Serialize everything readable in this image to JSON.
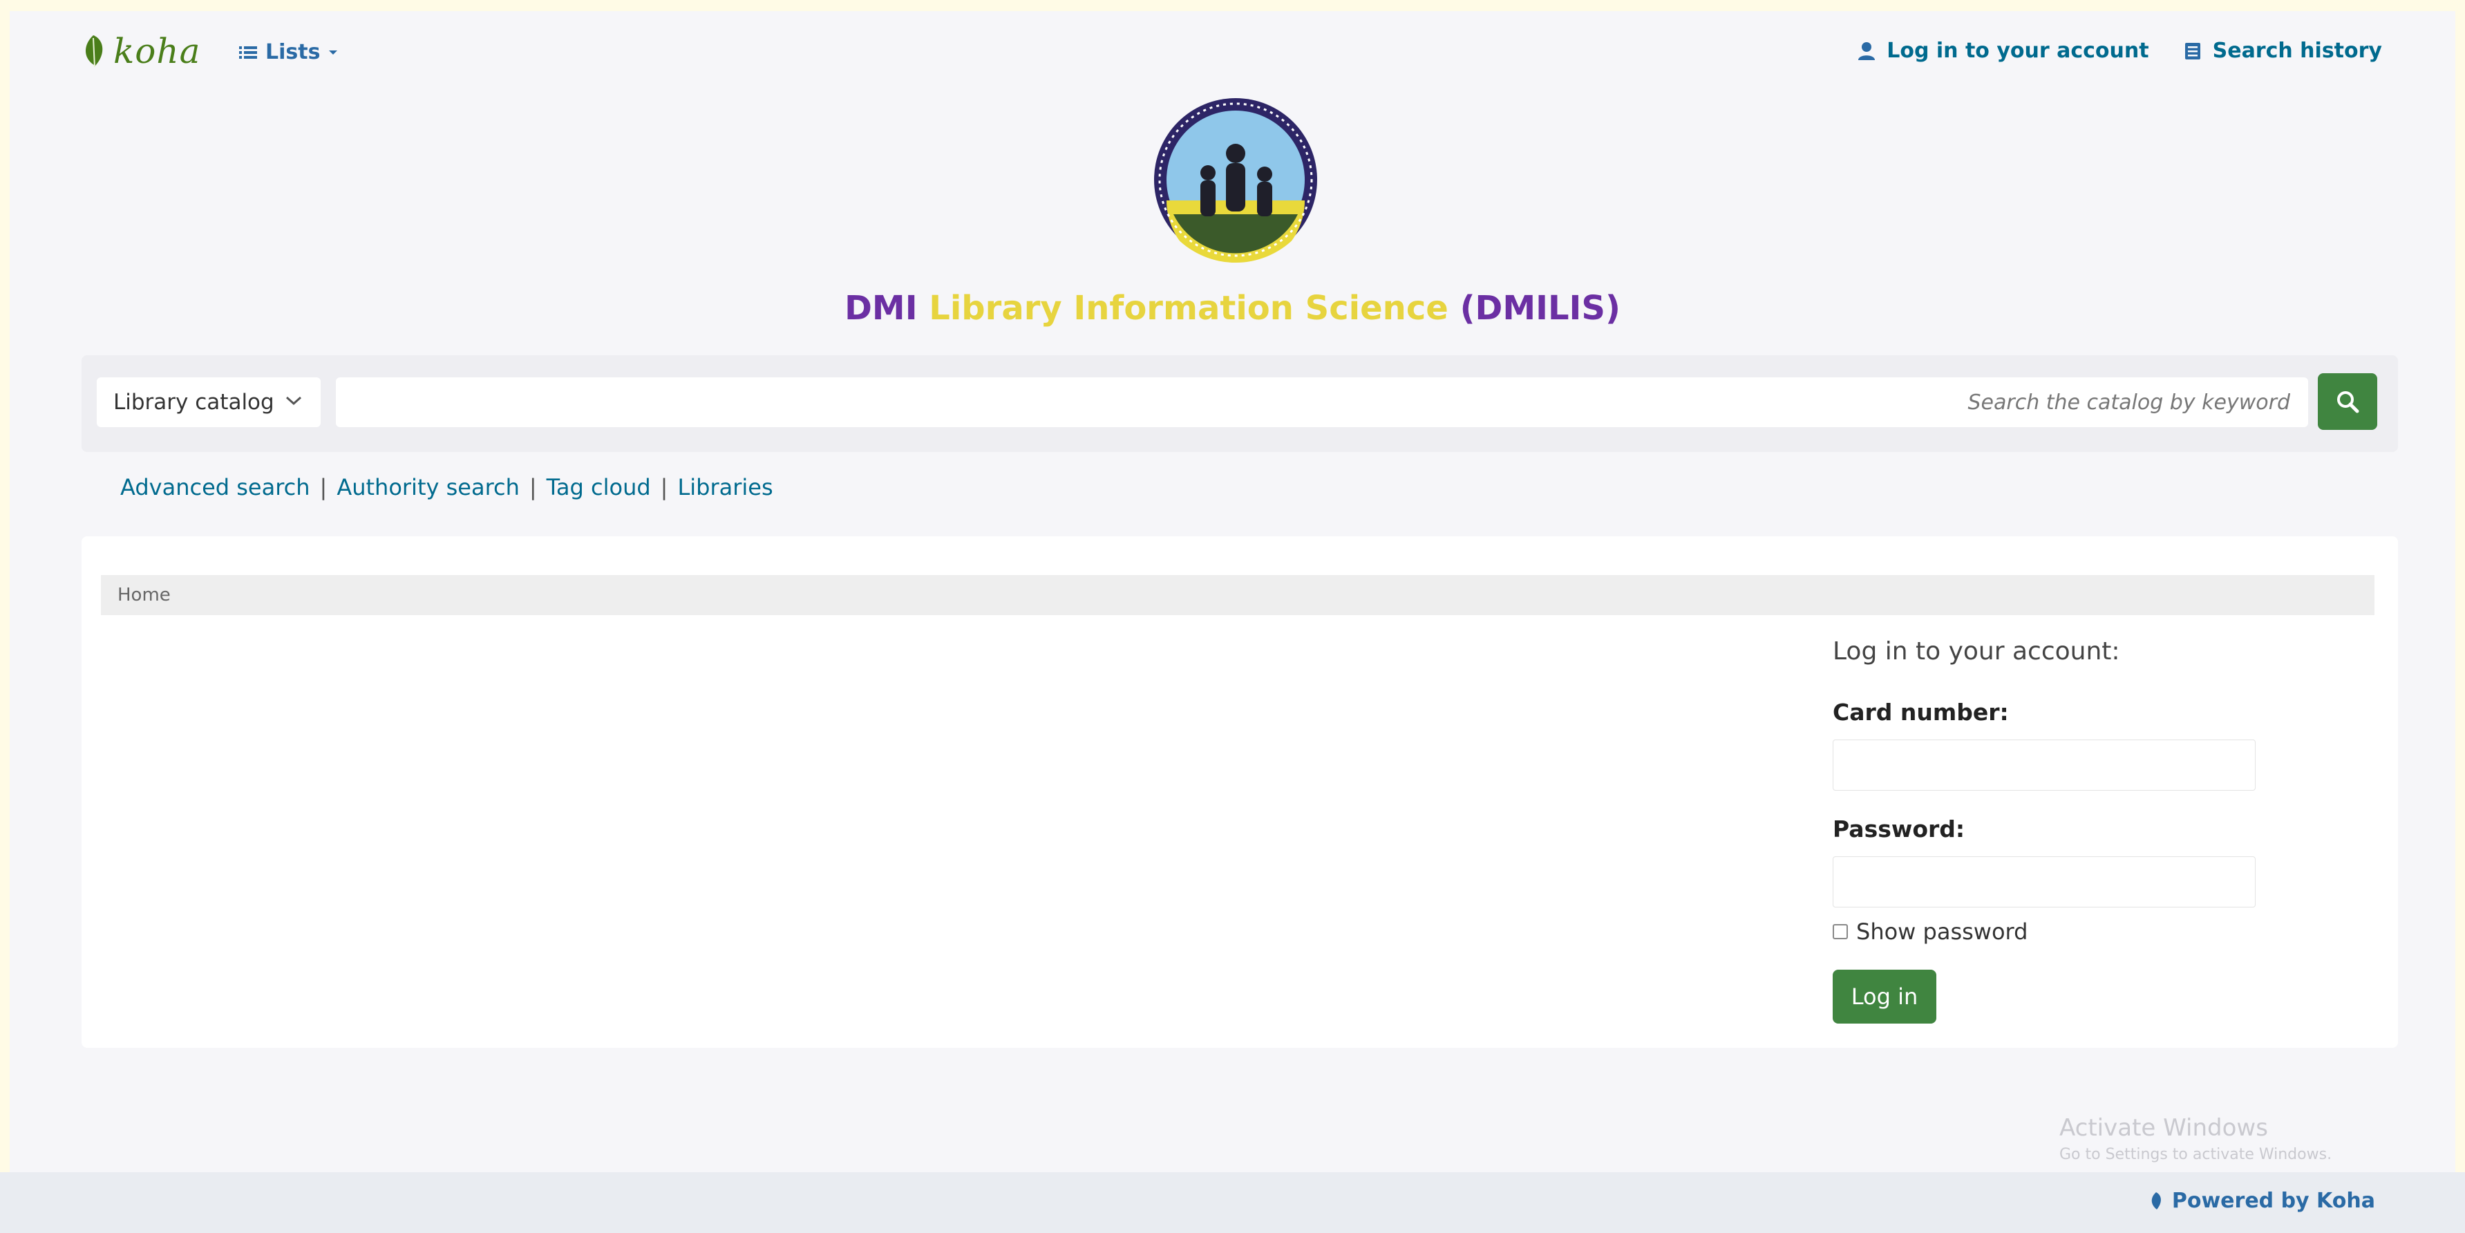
{
  "header": {
    "logo_text": "koha",
    "lists_label": "Lists",
    "login_link": "Log in to your account",
    "search_history_link": "Search history"
  },
  "library": {
    "name_part1": "DMI",
    "name_part2": "Library Information Science",
    "name_part3": "(DMILIS)"
  },
  "search": {
    "catalog_select": "Library catalog",
    "placeholder": "Search the catalog by keyword"
  },
  "search_links": {
    "advanced": "Advanced search",
    "authority": "Authority search",
    "tag_cloud": "Tag cloud",
    "libraries": "Libraries",
    "separator": "|"
  },
  "breadcrumb": {
    "home": "Home"
  },
  "login": {
    "heading": "Log in to your account:",
    "card_label": "Card number:",
    "password_label": "Password:",
    "show_password": "Show password",
    "button": "Log in"
  },
  "watermark": {
    "title": "Activate Windows",
    "subtitle": "Go to Settings to activate Windows."
  },
  "footer": {
    "powered_by": "Powered by Koha"
  },
  "colors": {
    "koha_green": "#408540",
    "link_blue": "#2a6aa5",
    "library_purple": "#6b2fa3",
    "library_yellow": "#e7d43f"
  }
}
